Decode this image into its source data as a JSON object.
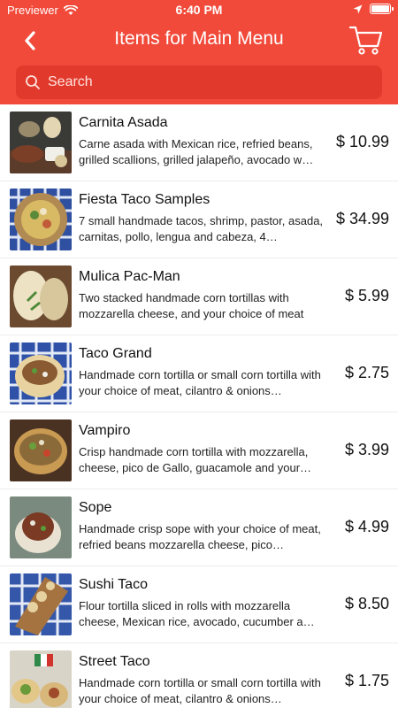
{
  "status_bar": {
    "carrier": "Previewer",
    "time": "6:40 PM"
  },
  "nav": {
    "title": "Items for Main Menu"
  },
  "search": {
    "placeholder": "Search"
  },
  "menu_items": [
    {
      "name": "Carnita Asada",
      "description": "Carne asada with Mexican rice, refried beans, grilled scallions, grilled jalapeño, avocado w…",
      "price": "$ 10.99"
    },
    {
      "name": "Fiesta Taco Samples",
      "description": "7 small handmade tacos, shrimp, pastor, asada, carnitas, pollo, lengua and cabeza, 4…",
      "price": "$ 34.99"
    },
    {
      "name": "Mulica Pac-Man",
      "description": "Two stacked handmade corn tortillas with mozzarella cheese, and your choice of meat",
      "price": "$ 5.99"
    },
    {
      "name": "Taco Grand",
      "description": "Handmade corn tortilla or small corn tortilla with your choice of meat, cilantro & onions…",
      "price": "$ 2.75"
    },
    {
      "name": "Vampiro",
      "description": "Crisp handmade corn tortilla with mozzarella, cheese, pico de Gallo, guacamole and your…",
      "price": "$ 3.99"
    },
    {
      "name": "Sope",
      "description": "Handmade crisp sope with your choice of meat, refried beans mozzarella cheese, pico…",
      "price": "$ 4.99"
    },
    {
      "name": "Sushi Taco",
      "description": "Flour tortilla sliced in rolls with mozzarella cheese, Mexican rice, avocado, cucumber a…",
      "price": "$ 8.50"
    },
    {
      "name": "Street Taco",
      "description": "Handmade corn tortilla or small corn tortilla with your choice of meat, cilantro & onions…",
      "price": "$ 1.75"
    }
  ],
  "colors": {
    "header": "#f14a3a",
    "search_bg": "#e13a2d"
  },
  "icons": {
    "back": "chevron-left-icon",
    "cart": "cart-icon",
    "search": "search-icon"
  }
}
